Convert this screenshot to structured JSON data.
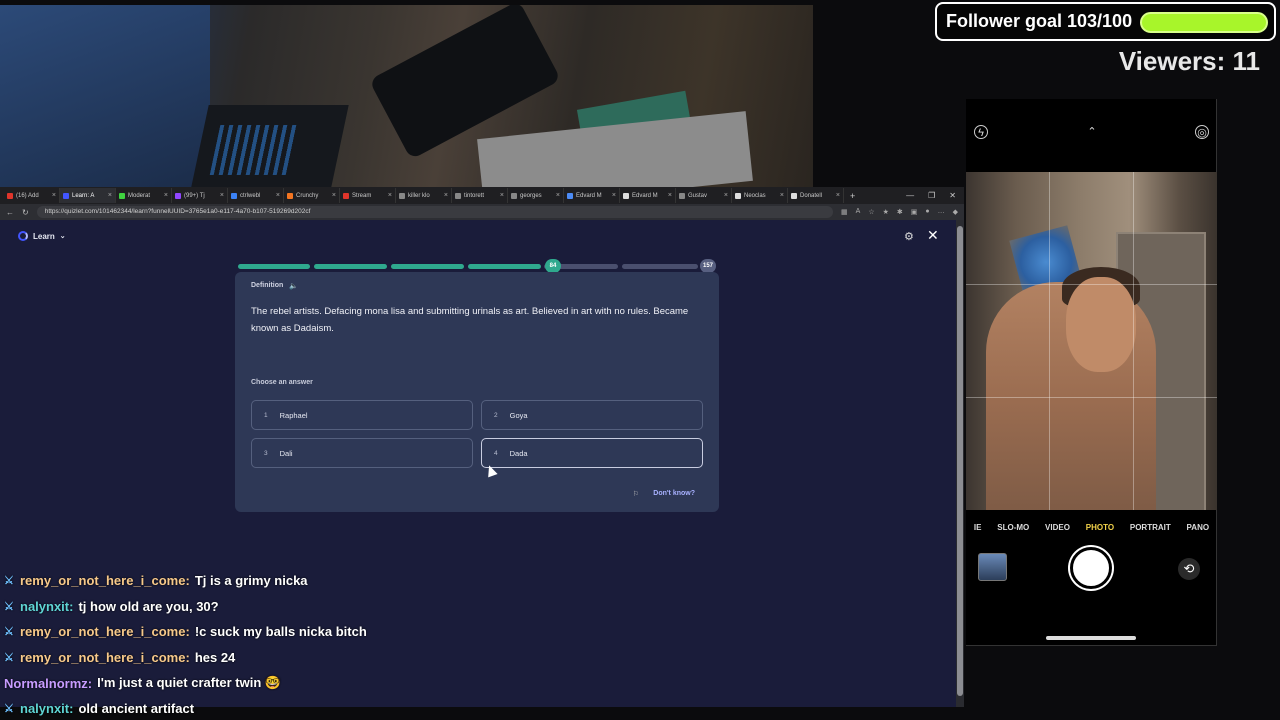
{
  "overlay": {
    "follower_goal_label": "Follower goal 103/100",
    "follower_goal_progress": 1.0,
    "follower_goal_bar_color": "#a8f52a",
    "viewers_label": "Viewers: 11"
  },
  "browser": {
    "tabs": [
      {
        "label": "(16) Add",
        "color": "#e0352b",
        "active": false
      },
      {
        "label": "Learn: A",
        "color": "#4255ff",
        "active": true
      },
      {
        "label": "Moderat",
        "color": "#3fd33f",
        "active": false
      },
      {
        "label": "(99+) Tj",
        "color": "#9146ff",
        "active": false
      },
      {
        "label": "ctrlwebl",
        "color": "#3b82f6",
        "active": false
      },
      {
        "label": "Crunchy",
        "color": "#f47521",
        "active": false
      },
      {
        "label": "Stream",
        "color": "#e0352b",
        "active": false
      },
      {
        "label": "killer klo",
        "color": "#888888",
        "active": false
      },
      {
        "label": "tintorett",
        "color": "#888888",
        "active": false
      },
      {
        "label": "georges",
        "color": "#888888",
        "active": false
      },
      {
        "label": "Edvard M",
        "color": "#4c8bf5",
        "active": false
      },
      {
        "label": "Edvard M",
        "color": "#dddddd",
        "active": false
      },
      {
        "label": "Gustav",
        "color": "#888888",
        "active": false
      },
      {
        "label": "Neoclas",
        "color": "#dddddd",
        "active": false
      },
      {
        "label": "Donatell",
        "color": "#dddddd",
        "active": false
      }
    ],
    "new_tab": "+",
    "url": "https://quizlet.com/101462344/learn?funnelUUID=3765e1a0-e117-4a70-b107-519269d202cf"
  },
  "learn": {
    "header": "Learn",
    "progress_current": "84",
    "progress_total": "157",
    "progress_fraction": 0.535,
    "definition_label": "Definition",
    "question": "The rebel artists. Defacing mona lisa and submitting urinals as art. Believed in art with no rules. Became known as Dadaism.",
    "choose_label": "Choose an answer",
    "options": [
      {
        "num": "1",
        "label": "Raphael"
      },
      {
        "num": "2",
        "label": "Goya"
      },
      {
        "num": "3",
        "label": "Dali"
      },
      {
        "num": "4",
        "label": "Dada"
      }
    ],
    "dont_know": "Don't know?"
  },
  "chat": [
    {
      "user": "remy_or_not_here_i_come:",
      "color": "#f7c98a",
      "text": "Tj is a grimy nicka",
      "badge": true
    },
    {
      "user": "nalynxit:",
      "color": "#5fd4d4",
      "text": "tj how old are you, 30?",
      "badge": true
    },
    {
      "user": "remy_or_not_here_i_come:",
      "color": "#f7c98a",
      "text": "!c suck my balls nicka bitch",
      "badge": true
    },
    {
      "user": "remy_or_not_here_i_come:",
      "color": "#f7c98a",
      "text": "hes 24",
      "badge": true
    },
    {
      "user": "Normalnormz:",
      "color": "#c79cff",
      "text": "I'm just a quiet crafter twin 🤓",
      "badge": false
    },
    {
      "user": "nalynxit:",
      "color": "#5fd4d4",
      "text": "old ancient artifact",
      "badge": true
    }
  ],
  "phone": {
    "modes": [
      "IE",
      "SLO-MO",
      "VIDEO",
      "PHOTO",
      "PORTRAIT",
      "PANO"
    ],
    "active_mode": "PHOTO"
  }
}
